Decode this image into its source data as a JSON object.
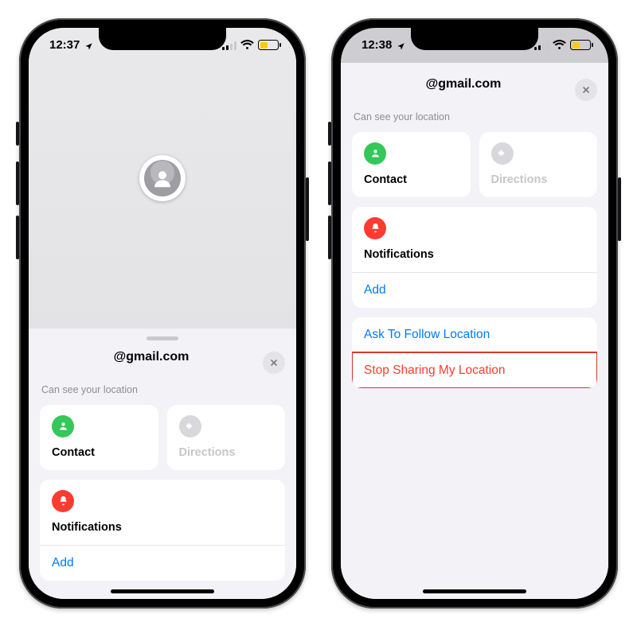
{
  "phoneA": {
    "status": {
      "time": "12:37"
    },
    "sheet": {
      "title": "@gmail.com",
      "subtitle": "Can see your location",
      "tiles": {
        "contact": "Contact",
        "directions": "Directions"
      },
      "notifications": {
        "heading": "Notifications",
        "add": "Add"
      }
    }
  },
  "phoneB": {
    "status": {
      "time": "12:38"
    },
    "sheet": {
      "title": "@gmail.com",
      "subtitle": "Can see your location",
      "tiles": {
        "contact": "Contact",
        "directions": "Directions"
      },
      "notifications": {
        "heading": "Notifications",
        "add": "Add"
      },
      "actions": {
        "ask": "Ask To Follow Location",
        "stop": "Stop Sharing My Location"
      }
    }
  }
}
